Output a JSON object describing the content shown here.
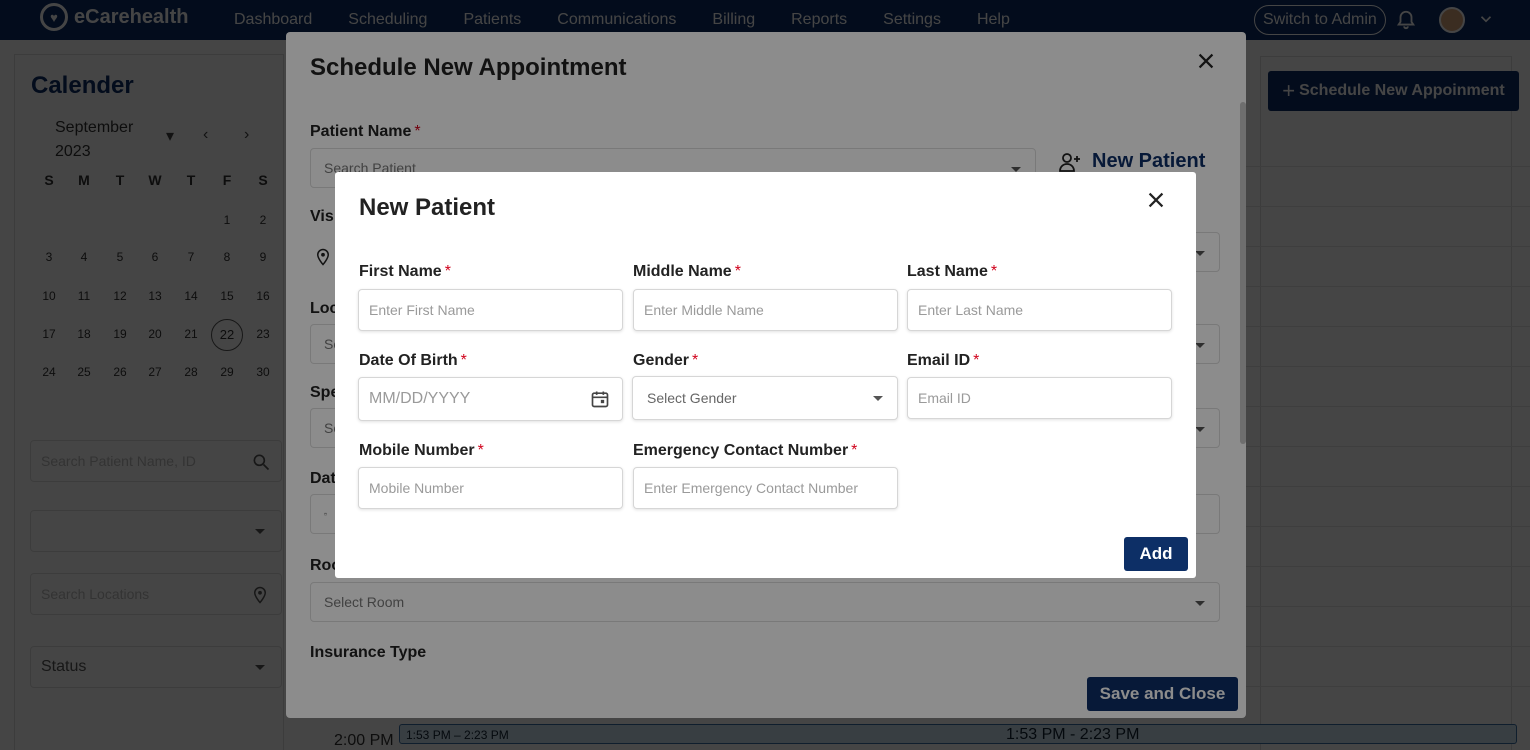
{
  "nav": {
    "brand": "eCarehealth",
    "items": [
      "Dashboard",
      "Scheduling",
      "Patients",
      "Communications",
      "Billing",
      "Reports",
      "Settings",
      "Help"
    ],
    "switch_admin": "Switch to Admin"
  },
  "calendar": {
    "title": "Calender",
    "month": "September",
    "year": "2023",
    "weekdays": [
      "S",
      "M",
      "T",
      "W",
      "T",
      "F",
      "S"
    ],
    "weeks": [
      [
        "",
        "",
        "",
        "",
        "",
        "1",
        "2"
      ],
      [
        "3",
        "4",
        "5",
        "6",
        "7",
        "8",
        "9"
      ],
      [
        "10",
        "11",
        "12",
        "13",
        "14",
        "15",
        "16"
      ],
      [
        "17",
        "18",
        "19",
        "20",
        "21",
        "22",
        "23"
      ],
      [
        "24",
        "25",
        "26",
        "27",
        "28",
        "29",
        "30"
      ]
    ],
    "today": "22"
  },
  "filters": {
    "search_placeholder": "Search Patient Name, ID",
    "location_placeholder": "Search Locations",
    "status_placeholder": "Status"
  },
  "page": {
    "schedule_button": "Schedule New Appoinment",
    "time_label": "2:00 PM",
    "event_short": "1:53 PM – 2:23 PM",
    "event_long": "1:53 PM - 2:23 PM"
  },
  "schedule_modal": {
    "title": "Schedule New Appointment",
    "patient_name_label": "Patient Name",
    "patient_search_placeholder": "Search Patient",
    "new_patient_link": "New Patient",
    "partial_labels": {
      "visit": "Vis",
      "location": "Loc",
      "specialty": "Spe",
      "date": "Dat",
      "room": "Roo"
    },
    "partial_placeholder_1": "Se",
    "partial_placeholder_2": "Se",
    "room_placeholder": "Select Room",
    "insurance_type_label": "Insurance Type",
    "save_button": "Save and Close"
  },
  "new_patient_modal": {
    "title": "New Patient",
    "fields": {
      "first_name": {
        "label": "First Name",
        "placeholder": "Enter First Name"
      },
      "middle_name": {
        "label": "Middle Name",
        "placeholder": "Enter Middle Name"
      },
      "last_name": {
        "label": "Last Name",
        "placeholder": "Enter Last Name"
      },
      "dob": {
        "label": "Date Of Birth",
        "placeholder": "MM/DD/YYYY"
      },
      "gender": {
        "label": "Gender",
        "placeholder": "Select Gender"
      },
      "email": {
        "label": "Email ID",
        "placeholder": "Email ID"
      },
      "mobile": {
        "label": "Mobile Number",
        "placeholder": "Mobile Number"
      },
      "emergency": {
        "label": "Emergency Contact Number",
        "placeholder": "Enter Emergency Contact Number"
      }
    },
    "required_mark": "*",
    "add_button": "Add"
  },
  "colors": {
    "brand": "#0d2f66",
    "required": "#d0021b",
    "event_fill": "#cfe3f3"
  }
}
